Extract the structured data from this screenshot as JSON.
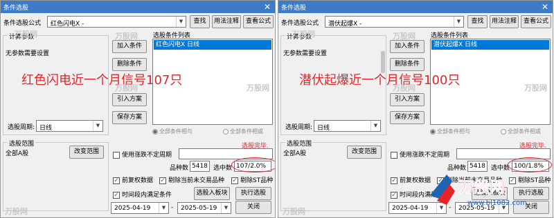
{
  "windows": [
    {
      "title": "条件选股",
      "formula_label": "条件选股公式",
      "formula_value": "红色闪电X  -",
      "find_btn": "查找",
      "usage_btn": "用法注释",
      "view_btn": "查看公式",
      "params_title": "计算参数",
      "no_params": "无参数需要设置",
      "list_title": "选股条件列表",
      "list_item": "红色闪电X  日线",
      "add_btn": "加入条件",
      "delete_btn": "删除条件",
      "import_btn": "引入方案",
      "save_btn": "保存方案",
      "period_label": "选股周期:",
      "period_value": "日线",
      "radio_and": "全部条件相与",
      "radio_or": "全部条件相或",
      "overlay": "红色闪电近一个月信号107只",
      "range_title": "选股范围",
      "range_value": "全部A股",
      "change_range_btn": "改变范围",
      "done_text": "选股完毕.",
      "use_unfixed": "使用涨跌不定周期",
      "count_label": "品种数",
      "count_value": "5418",
      "selected_label": "选中数",
      "selected_value": "107/2.0%",
      "chk_forward": "前复权数据",
      "chk_remove_untraded": "剔除当前未交易品种",
      "chk_remove_st": "剔除ST品种",
      "chk_time_cond": "时间段内满足条件",
      "select_into_btn": "选股入板块",
      "run_btn": "执行选股",
      "date_from": "2025-04-19",
      "date_sep": "-",
      "date_to": "2025-05-19",
      "close_btn": "关闭"
    },
    {
      "title": "条件选股",
      "formula_label": "条件选股公式",
      "formula_value": "潜伏起爆X  -",
      "find_btn": "查找",
      "usage_btn": "用法注释",
      "view_btn": "查看公式",
      "params_title": "计算参数",
      "no_params": "无参数需要设置",
      "list_title": "选股条件列表",
      "list_item": "潜伏起爆X  日线",
      "add_btn": "加入条件",
      "delete_btn": "删除条件",
      "import_btn": "引入方案",
      "save_btn": "保存方案",
      "period_label": "选股周期:",
      "period_value": "日线",
      "radio_and": "全部条件相与",
      "radio_or": "全部条件相或",
      "overlay": "潜伏起爆近一个月信号100只",
      "range_title": "选股范围",
      "range_value": "全部A股",
      "change_range_btn": "改变范围",
      "done_text": "选股完毕.",
      "use_unfixed": "使用涨跌不定周期",
      "count_label": "品种数",
      "count_value": "5418",
      "selected_label": "选中数",
      "selected_value": "100/1.8%",
      "chk_forward": "前复权数据",
      "chk_remove_untraded": "剔除当前未交易品种",
      "chk_remove_st": "剔除ST品种",
      "chk_time_cond": "时间段内满足条件",
      "select_into_btn": "选股入板块",
      "run_btn": "执行选股",
      "date_from": "2025-04-19",
      "date_sep": "-",
      "date_to": "2025-05-19",
      "close_btn": "关闭"
    }
  ],
  "watermark": "万股网",
  "logo_text": "万股网",
  "logo_url": "www.bl1082.com",
  "colors": {
    "title_bar": "#3d7ac7",
    "accent_red": "#e8232a",
    "selected_blue": "#0078d7"
  }
}
